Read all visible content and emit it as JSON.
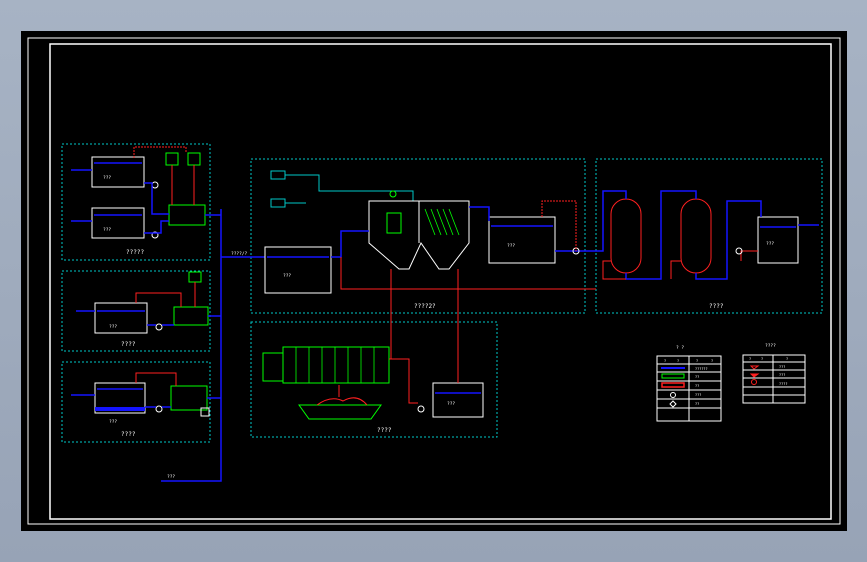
{
  "colors": {
    "background": "#000000",
    "frame": "#ffffff",
    "panel_border": "#00c8c8",
    "water_line": "#1414ff",
    "sludge_line": "#ff2020",
    "equipment": "#00ff00",
    "text": "#ffffff"
  },
  "panels": {
    "left_top": {
      "caption": "?????"
    },
    "left_mid": {
      "caption": "????"
    },
    "left_bottom": {
      "caption": "????"
    },
    "main_process": {
      "caption": "????2?"
    },
    "sludge": {
      "caption": "????"
    },
    "deep_treatment": {
      "caption": "????"
    }
  },
  "labels": {
    "inlet_main": "????/?",
    "outlet": "???",
    "tank_a1": "???",
    "tank_a2": "???",
    "tank_b": "???",
    "tank_c": "???",
    "tank_reg": "???",
    "tank_clear": "???",
    "tank_sludge": "???",
    "tank_final": "???"
  },
  "legend_left": {
    "title": "? ?",
    "header": [
      "?",
      "?",
      "?",
      "?"
    ],
    "rows": [
      "??????",
      "??",
      "??",
      "???",
      "??"
    ]
  },
  "legend_right": {
    "title": "????",
    "header": [
      "?",
      "?",
      "?"
    ],
    "rows": [
      "???",
      "???",
      "????"
    ]
  }
}
